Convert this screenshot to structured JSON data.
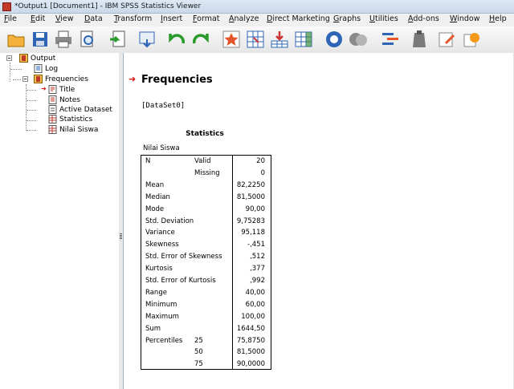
{
  "window": {
    "title": "*Output1 [Document1] - IBM SPSS Statistics Viewer"
  },
  "menu": [
    "File",
    "Edit",
    "View",
    "Data",
    "Transform",
    "Insert",
    "Format",
    "Analyze",
    "Direct Marketing",
    "Graphs",
    "Utilities",
    "Add-ons",
    "Window",
    "Help"
  ],
  "outline": {
    "root": "Output",
    "log": "Log",
    "frequencies": "Frequencies",
    "children": [
      "Title",
      "Notes",
      "Active Dataset",
      "Statistics",
      "Nilai Siswa"
    ]
  },
  "doc": {
    "heading": "Frequencies",
    "dataset": "[DataSet0]",
    "table_title": "Statistics",
    "variable": "Nilai Siswa",
    "rows": [
      {
        "label": "N",
        "sub": "Valid",
        "value": "20"
      },
      {
        "label": "",
        "sub": "Missing",
        "value": "0"
      },
      {
        "label": "Mean",
        "sub": "",
        "value": "82,2250"
      },
      {
        "label": "Median",
        "sub": "",
        "value": "81,5000"
      },
      {
        "label": "Mode",
        "sub": "",
        "value": "90,00"
      },
      {
        "label": "Std. Deviation",
        "sub": "",
        "value": "9,75283"
      },
      {
        "label": "Variance",
        "sub": "",
        "value": "95,118"
      },
      {
        "label": "Skewness",
        "sub": "",
        "value": "-,451"
      },
      {
        "label": "Std. Error of Skewness",
        "sub": "",
        "value": ",512"
      },
      {
        "label": "Kurtosis",
        "sub": "",
        "value": ",377"
      },
      {
        "label": "Std. Error of Kurtosis",
        "sub": "",
        "value": ",992"
      },
      {
        "label": "Range",
        "sub": "",
        "value": "40,00"
      },
      {
        "label": "Minimum",
        "sub": "",
        "value": "60,00"
      },
      {
        "label": "Maximum",
        "sub": "",
        "value": "100,00"
      },
      {
        "label": "Sum",
        "sub": "",
        "value": "1644,50"
      },
      {
        "label": "Percentiles",
        "sub": "25",
        "value": "75,8750"
      },
      {
        "label": "",
        "sub": "50",
        "value": "81,5000"
      },
      {
        "label": "",
        "sub": "75",
        "value": "90,0000"
      }
    ]
  },
  "toolbar_icons": [
    "open-icon",
    "save-icon",
    "print-icon",
    "print-preview-icon",
    "export-icon",
    "recall-dialog-icon",
    "undo-icon",
    "redo-icon",
    "go-to-case-icon",
    "go-to-variable-icon",
    "insert-cases-icon",
    "variables-icon",
    "run-descriptives-icon",
    "circles-icon",
    "split-icon",
    "weight-icon",
    "select-cases-icon",
    "value-labels-icon",
    "show-all-icon"
  ],
  "colors": {
    "accent": "#d11111",
    "titlebar": "#c9d8ea"
  }
}
